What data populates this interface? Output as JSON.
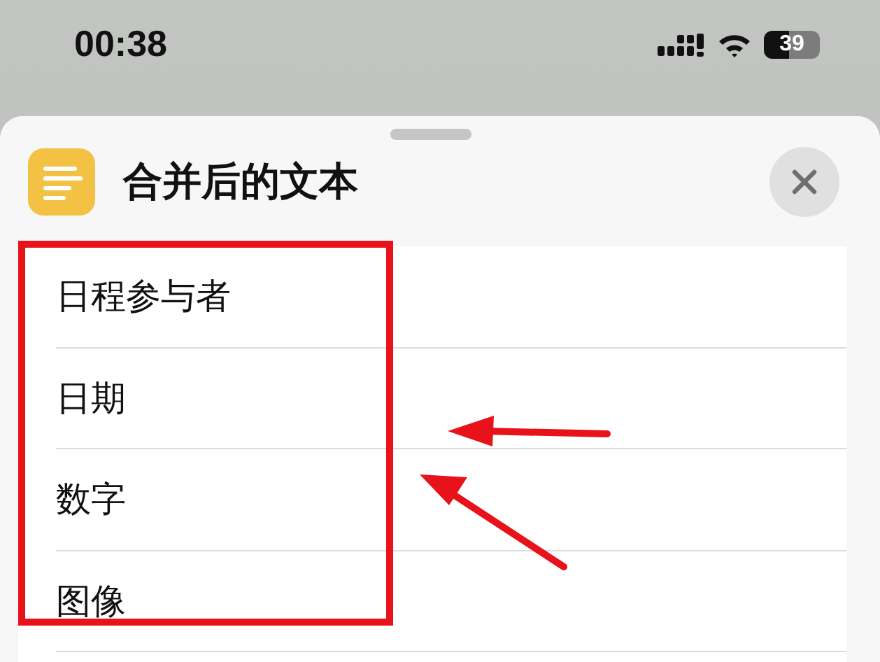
{
  "status_bar": {
    "time": "00:38",
    "battery": "39"
  },
  "sheet": {
    "title": "合并后的文本"
  },
  "list": {
    "items": [
      {
        "label": "日程参与者"
      },
      {
        "label": "日期"
      },
      {
        "label": "数字"
      },
      {
        "label": "图像"
      }
    ]
  }
}
